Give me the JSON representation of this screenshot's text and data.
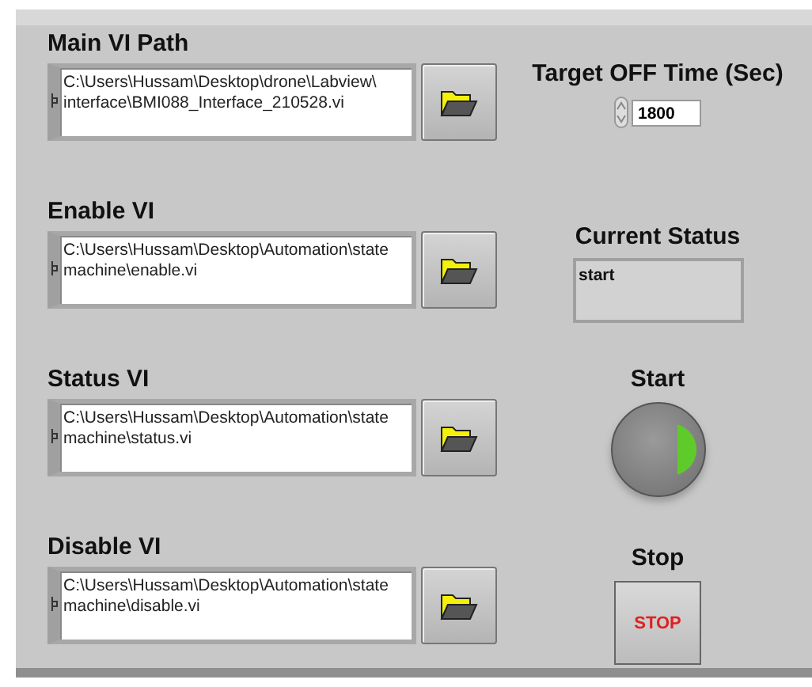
{
  "path_controls": [
    {
      "label": "Main VI Path",
      "lines": [
        "C:\\Users\\Hussam\\Desktop\\drone\\Labview\\",
        "interface\\BMI088_Interface_210528.vi"
      ]
    },
    {
      "label": "Enable VI",
      "lines": [
        "C:\\Users\\Hussam\\Desktop\\Automation\\state",
        "machine\\enable.vi"
      ]
    },
    {
      "label": "Status VI",
      "lines": [
        "C:\\Users\\Hussam\\Desktop\\Automation\\state",
        "machine\\status.vi"
      ]
    },
    {
      "label": "Disable VI",
      "lines": [
        "C:\\Users\\Hussam\\Desktop\\Automation\\state",
        "machine\\disable.vi"
      ]
    }
  ],
  "target_off_time": {
    "label": "Target OFF Time (Sec)",
    "value": "1800"
  },
  "current_status": {
    "label": "Current Status",
    "value": "start"
  },
  "start": {
    "label": "Start",
    "on": true
  },
  "stop": {
    "label": "Stop",
    "text": "STOP"
  }
}
